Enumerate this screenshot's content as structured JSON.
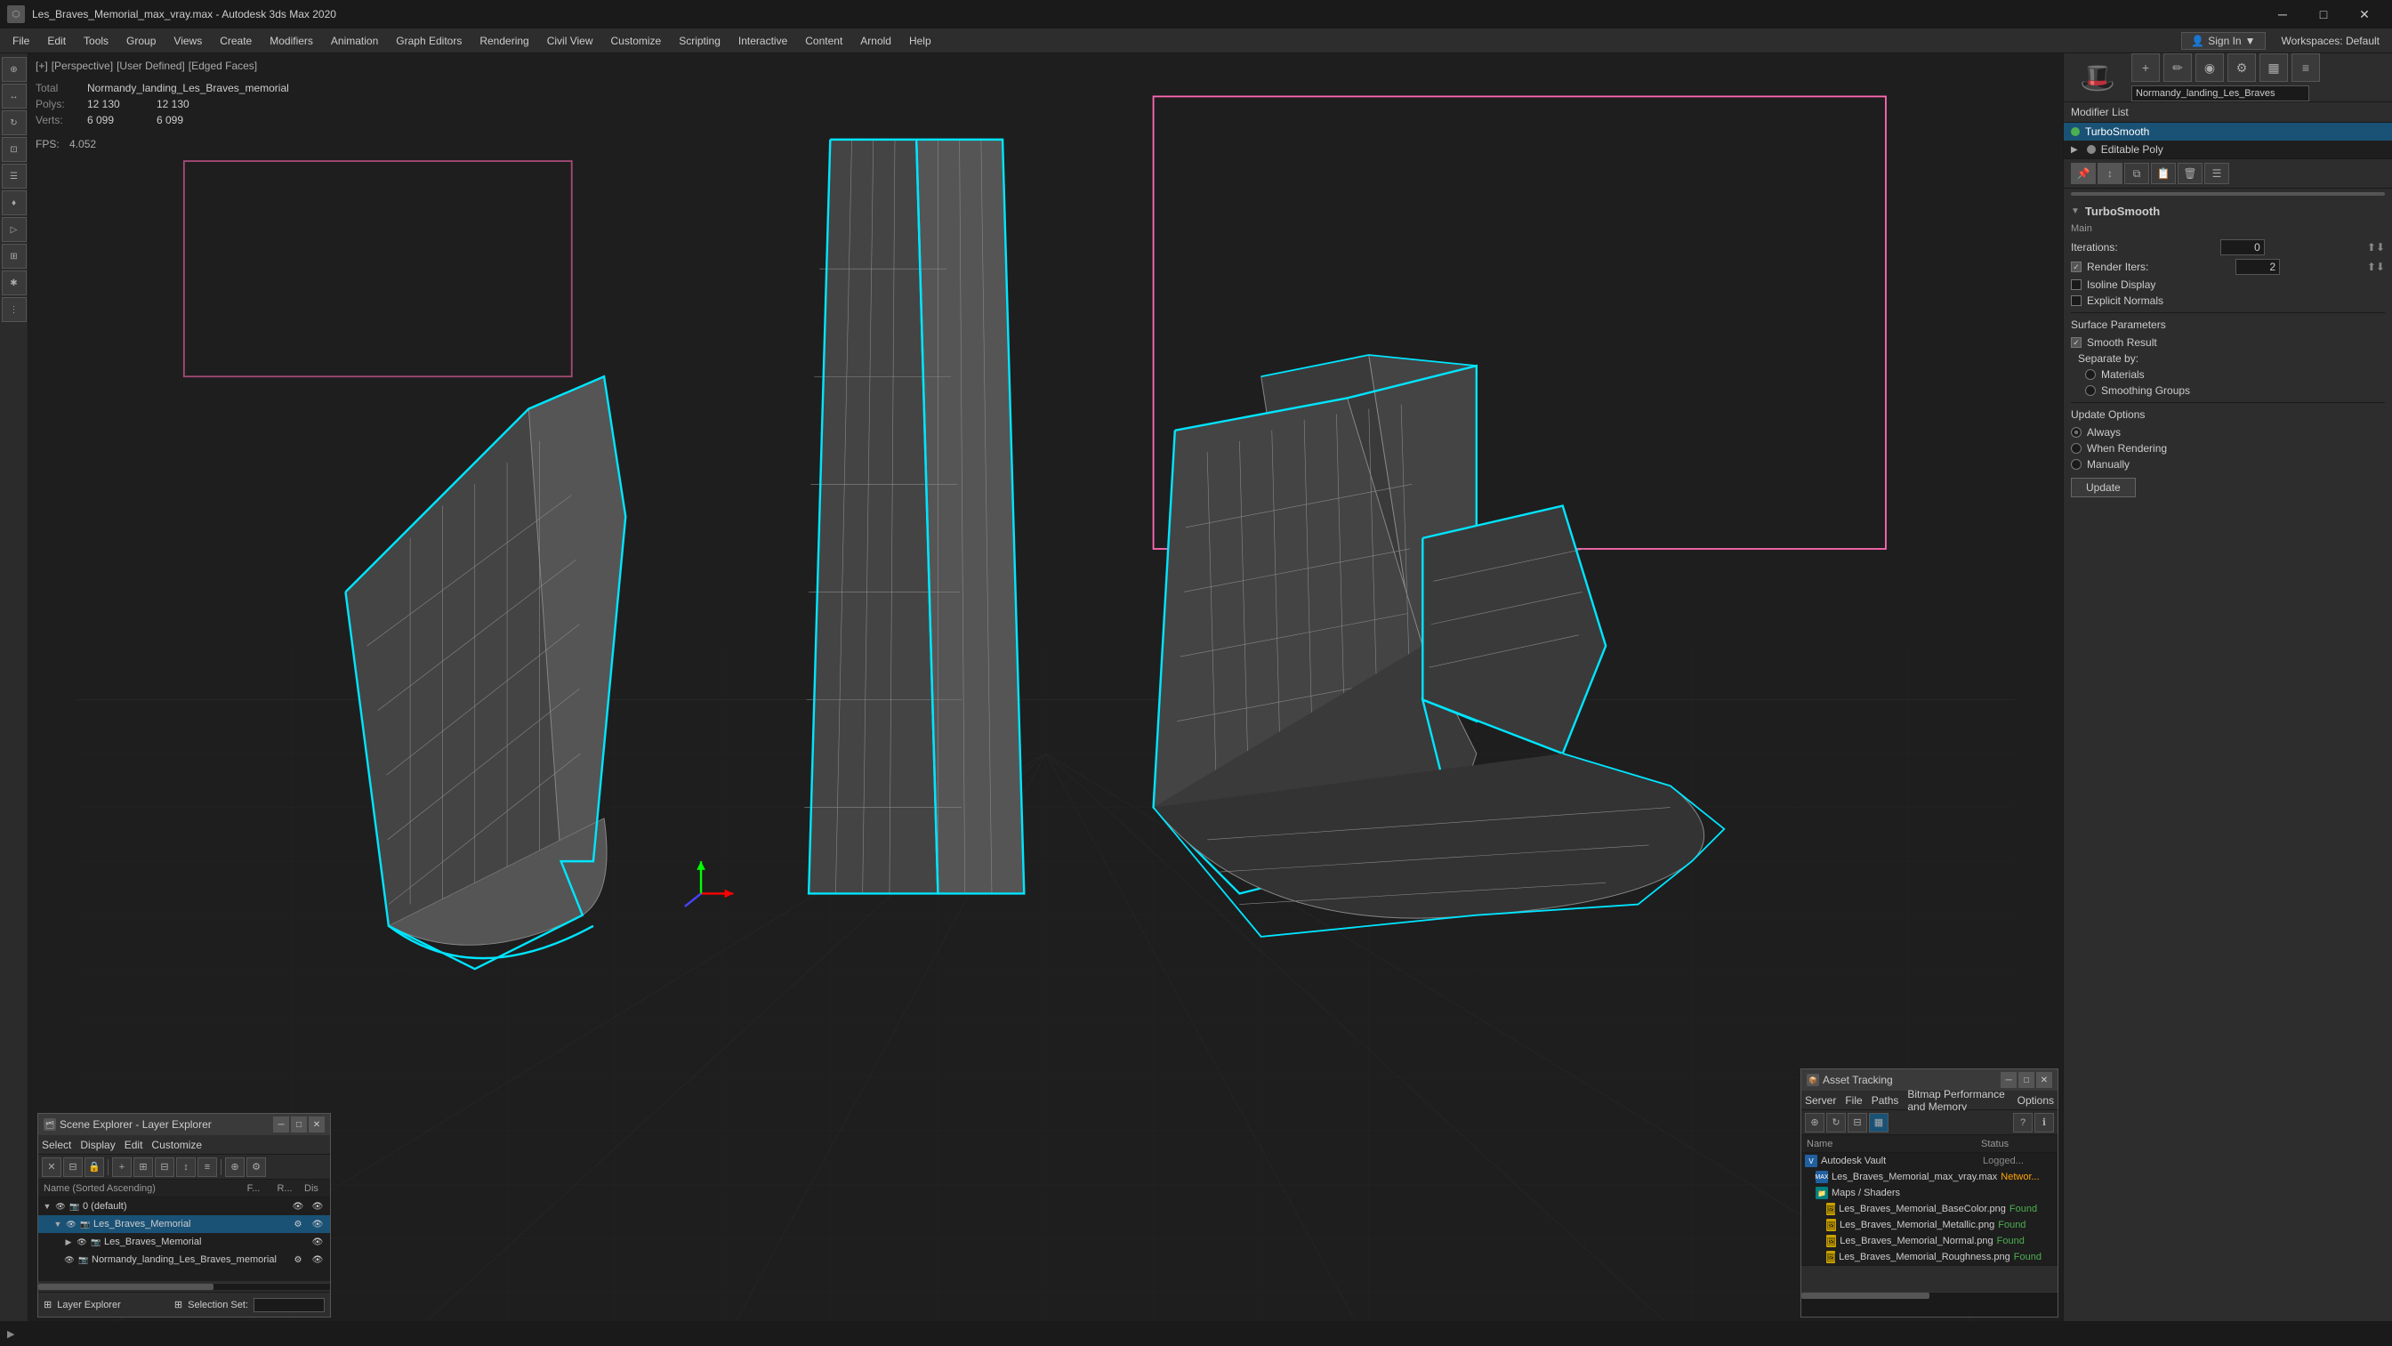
{
  "window": {
    "title": "Les_Braves_Memorial_max_vray.max - Autodesk 3ds Max 2020",
    "icon": "3dsmax"
  },
  "titlebar": {
    "minimize": "─",
    "maximize": "□",
    "close": "✕"
  },
  "menu": {
    "items": [
      "File",
      "Edit",
      "Tools",
      "Group",
      "Views",
      "Create",
      "Modifiers",
      "Animation",
      "Graph Editors",
      "Rendering",
      "Civil View",
      "Customize",
      "Scripting",
      "Interactive",
      "Content",
      "Arnold",
      "Help"
    ]
  },
  "signin": {
    "label": "Sign In",
    "icon": "👤"
  },
  "workspace": {
    "label": "Workspaces: Default"
  },
  "viewport": {
    "bracket": "[+]",
    "mode": "[Perspective]",
    "user_defined": "[User Defined]",
    "edged_faces": "[Edged Faces]"
  },
  "stats": {
    "total_label": "Total",
    "total_value": "Normandy_landing_Les_Braves_memorial",
    "polys_label": "Polys:",
    "polys_left": "12 130",
    "polys_right": "12 130",
    "verts_label": "Verts:",
    "verts_left": "6 099",
    "verts_right": "6 099",
    "fps_label": "FPS:",
    "fps_value": "4.052"
  },
  "right_panel": {
    "name_value": "Normandy_landing_Les_Braves",
    "modifier_list_label": "Modifier List",
    "modifiers": [
      {
        "label": "TurboSmooth",
        "active": true,
        "dot": "green"
      },
      {
        "label": "Editable Poly",
        "active": false,
        "dot": "gray"
      }
    ],
    "turbosmooth": {
      "title": "TurboSmooth",
      "subtitle": "Main",
      "iterations_label": "Iterations:",
      "iterations_value": "0",
      "render_iters_label": "Render Iters:",
      "render_iters_value": "2",
      "isoline_display_label": "Isoline Display",
      "explicit_normals_label": "Explicit Normals",
      "surface_params_title": "Surface Parameters",
      "smooth_result_label": "Smooth Result",
      "smooth_result_checked": true,
      "separate_by_label": "Separate by:",
      "materials_label": "Materials",
      "smoothing_groups_label": "Smoothing Groups",
      "update_options_title": "Update Options",
      "always_label": "Always",
      "when_rendering_label": "When Rendering",
      "manually_label": "Manually",
      "update_btn": "Update"
    }
  },
  "scene_explorer": {
    "title": "Scene Explorer - Layer Explorer",
    "menu_items": [
      "Select",
      "Display",
      "Edit",
      "Customize"
    ],
    "columns": [
      "Name (Sorted Ascending)",
      "F...",
      "R...",
      "Dis"
    ],
    "rows": [
      {
        "indent": 0,
        "label": "0 (default)",
        "expanded": true,
        "selected": false,
        "icons": [
          "eye",
          "camera"
        ]
      },
      {
        "indent": 1,
        "label": "Les_Braves_Memorial",
        "expanded": true,
        "selected": true,
        "icons": [
          "eye",
          "camera"
        ]
      },
      {
        "indent": 2,
        "label": "Les_Braves_Memorial",
        "expanded": false,
        "selected": false,
        "icons": [
          "eye",
          "camera"
        ]
      },
      {
        "indent": 2,
        "label": "Normandy_landing_Les_Braves_memorial",
        "expanded": false,
        "selected": false,
        "icons": [
          "eye",
          "camera"
        ]
      }
    ],
    "bottom_label": "Layer Explorer",
    "selection_set": "Selection Set:"
  },
  "asset_tracking": {
    "title": "Asset Tracking",
    "menu_items": [
      "Server",
      "File",
      "Paths",
      "Bitmap Performance and Memory",
      "Options"
    ],
    "columns": [
      "Name",
      "Status"
    ],
    "rows": [
      {
        "label": "Autodesk Vault",
        "status": "Logged...",
        "icon": "vault",
        "indent": 0
      },
      {
        "label": "Les_Braves_Memorial_max_vray.max",
        "status": "Networ...",
        "icon": "max",
        "indent": 1
      },
      {
        "label": "Maps / Shaders",
        "status": "",
        "icon": "folder",
        "indent": 1
      },
      {
        "label": "Les_Braves_Memorial_BaseColor.png",
        "status": "Found",
        "icon": "img",
        "indent": 2
      },
      {
        "label": "Les_Braves_Memorial_Metallic.png",
        "status": "Found",
        "icon": "img",
        "indent": 2
      },
      {
        "label": "Les_Braves_Memorial_Normal.png",
        "status": "Found",
        "icon": "img",
        "indent": 2
      },
      {
        "label": "Les_Braves_Memorial_Roughness.png",
        "status": "Found",
        "icon": "img",
        "indent": 2
      }
    ]
  },
  "colors": {
    "accent_blue": "#1a5276",
    "turbosmooth_highlight": "#1a5276",
    "cyan": "#00e5ff",
    "pink": "#ff69b4",
    "found_green": "#4CAF50",
    "network_orange": "#FFA500"
  }
}
